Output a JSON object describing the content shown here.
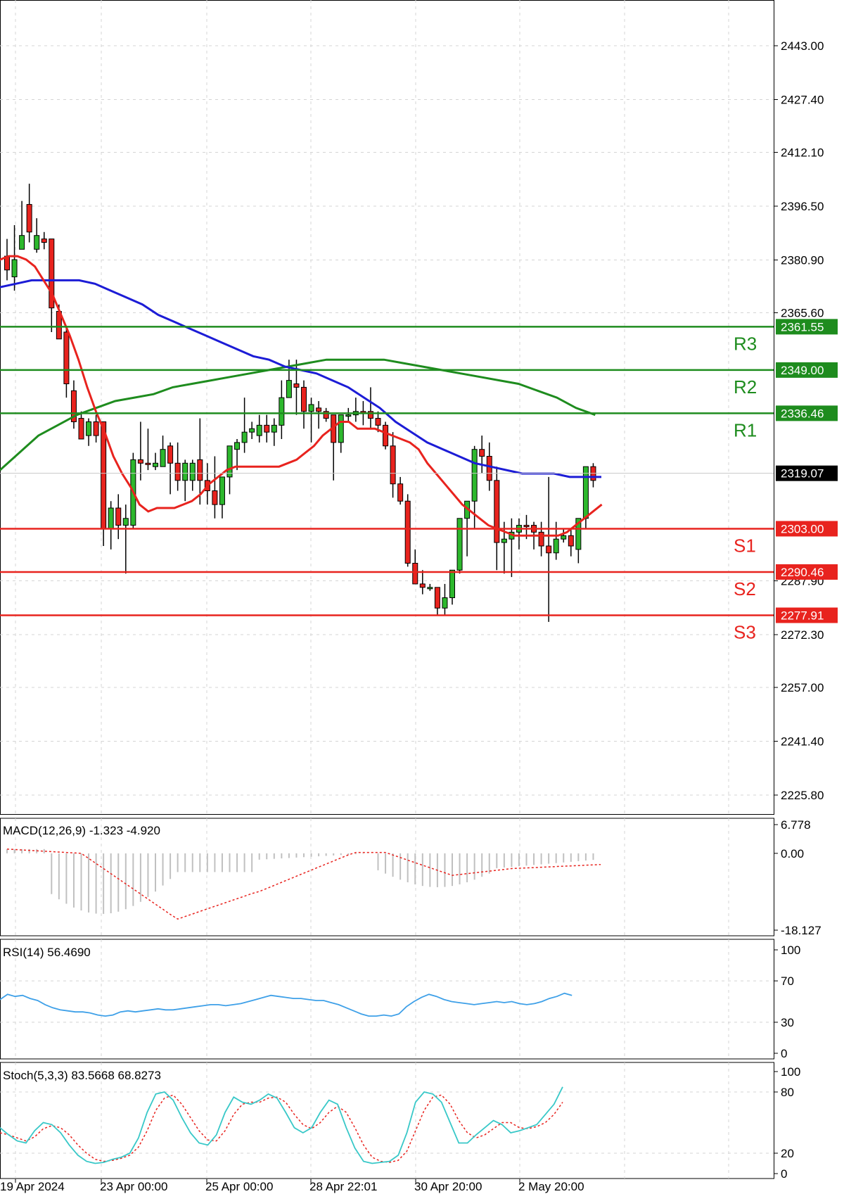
{
  "chart_data": {
    "type": "candlestick",
    "price_axis": {
      "ticks": [
        "2443.00",
        "2427.40",
        "2412.10",
        "2396.50",
        "2380.90",
        "2365.60",
        "2287.90",
        "2272.30",
        "2257.00",
        "2241.40",
        "2225.80"
      ],
      "tick_values": [
        2443.0,
        2427.4,
        2412.1,
        2396.5,
        2380.9,
        2365.6,
        2287.9,
        2272.3,
        2257.0,
        2241.4,
        2225.8
      ]
    },
    "current_price": {
      "label": "2319.07",
      "value": 2319.07
    },
    "levels": [
      {
        "name": "R3",
        "label": "2361.55",
        "value": 2361.55,
        "color": "#1e8c1e"
      },
      {
        "name": "R2",
        "label": "2349.00",
        "value": 2349.0,
        "color": "#1e8c1e"
      },
      {
        "name": "R1",
        "label": "2336.46",
        "value": 2336.46,
        "color": "#1e8c1e"
      },
      {
        "name": "S1",
        "label": "2303.00",
        "value": 2303.0,
        "color": "#e8231e"
      },
      {
        "name": "S2",
        "label": "2290.46",
        "value": 2290.46,
        "color": "#e8231e"
      },
      {
        "name": "S3",
        "label": "2277.91",
        "value": 2277.91,
        "color": "#e8231e"
      }
    ],
    "time_labels": [
      "19 Apr 2024",
      "23 Apr 00:00",
      "25 Apr 00:00",
      "28 Apr 22:01",
      "30 Apr 20:00",
      "2 May 20:00"
    ],
    "candles": [
      [
        2382,
        2387,
        2378,
        2375,
        "bear"
      ],
      [
        2381,
        2391,
        2376,
        2372,
        "bull"
      ],
      [
        2388,
        2398,
        2384,
        2384,
        "bull"
      ],
      [
        2389,
        2403,
        2397,
        2386,
        "bear"
      ],
      [
        2388,
        2393,
        2384,
        2383,
        "bull"
      ],
      [
        2387,
        2389,
        2386,
        2384,
        "bear"
      ],
      [
        2387,
        2387,
        2367,
        2360,
        "bear"
      ],
      [
        2366,
        2368,
        2358,
        2358,
        "bear"
      ],
      [
        2360,
        2361,
        2345,
        2341,
        "bear"
      ],
      [
        2343,
        2346,
        2334,
        2332,
        "bear"
      ],
      [
        2335,
        2337,
        2329,
        2329,
        "bear"
      ],
      [
        2330,
        2335,
        2334,
        2327,
        "bull"
      ],
      [
        2334,
        2336,
        2330,
        2328,
        "bear"
      ],
      [
        2334,
        2334,
        2303,
        2298,
        "bear"
      ],
      [
        2303,
        2311,
        2309,
        2297,
        "bull"
      ],
      [
        2309,
        2313,
        2304,
        2300,
        "bear"
      ],
      [
        2304,
        2310,
        2306,
        2290,
        "bull"
      ],
      [
        2304,
        2325,
        2323,
        2303,
        "bull"
      ],
      [
        2323,
        2334,
        2322,
        2317,
        "bear"
      ],
      [
        2322,
        2332,
        2322,
        2320,
        "bear"
      ],
      [
        2321,
        2325,
        2322,
        2320,
        "bull"
      ],
      [
        2321,
        2330,
        2326,
        2321,
        "bull"
      ],
      [
        2327,
        2328,
        2322,
        2313,
        "bear"
      ],
      [
        2322,
        2328,
        2317,
        2314,
        "bear"
      ],
      [
        2317,
        2323,
        2322,
        2311,
        "bull"
      ],
      [
        2317,
        2323,
        2322,
        2314,
        "bull"
      ],
      [
        2323,
        2335,
        2317,
        2310,
        "bear"
      ],
      [
        2317,
        2322,
        2314,
        2310,
        "bear"
      ],
      [
        2314,
        2324,
        2310,
        2306,
        "bear"
      ],
      [
        2310,
        2318,
        2318,
        2306,
        "bull"
      ],
      [
        2318,
        2327,
        2327,
        2313,
        "bull"
      ],
      [
        2326,
        2329,
        2328,
        2320,
        "bull"
      ],
      [
        2328,
        2341,
        2331,
        2325,
        "bull"
      ],
      [
        2331,
        2334,
        2332,
        2329,
        "bull"
      ],
      [
        2330,
        2336,
        2333,
        2328,
        "bull"
      ],
      [
        2333,
        2336,
        2331,
        2328,
        "bear"
      ],
      [
        2331,
        2335,
        2333,
        2327,
        "bull"
      ],
      [
        2333,
        2346,
        2341,
        2329,
        "bull"
      ],
      [
        2341,
        2352,
        2346,
        2341,
        "bull"
      ],
      [
        2345,
        2352,
        2344,
        2336,
        "bear"
      ],
      [
        2344,
        2346,
        2337,
        2332,
        "bear"
      ],
      [
        2337,
        2341,
        2339,
        2328,
        "bull"
      ],
      [
        2338,
        2340,
        2337,
        2332,
        "bear"
      ],
      [
        2337,
        2338,
        2335,
        2334,
        "bear"
      ],
      [
        2336,
        2336,
        2328,
        2317,
        "bear"
      ],
      [
        2328,
        2335,
        2336,
        2325,
        "bull"
      ],
      [
        2336,
        2338,
        2336,
        2334,
        "bull"
      ],
      [
        2336,
        2341,
        2337,
        2334,
        "bull"
      ],
      [
        2337,
        2340,
        2337,
        2333,
        "bear"
      ],
      [
        2337,
        2344,
        2335,
        2332,
        "bear"
      ],
      [
        2335,
        2337,
        2333,
        2331,
        "bear"
      ],
      [
        2333,
        2334,
        2327,
        2326,
        "bear"
      ],
      [
        2327,
        2331,
        2316,
        2312,
        "bear"
      ],
      [
        2316,
        2318,
        2311,
        2310,
        "bear"
      ],
      [
        2311,
        2313,
        2293,
        2292,
        "bear"
      ],
      [
        2293,
        2297,
        2287,
        2287,
        "bear"
      ],
      [
        2287,
        2291,
        2286,
        2284,
        "bear"
      ],
      [
        2286,
        2287,
        2286,
        2285,
        "bull"
      ],
      [
        2286,
        2286,
        2280,
        2278,
        "bear"
      ],
      [
        2280,
        2287,
        2283,
        2278,
        "bull"
      ],
      [
        2283,
        2291,
        2291,
        2281,
        "bull"
      ],
      [
        2291,
        2306,
        2306,
        2290,
        "bull"
      ],
      [
        2306,
        2311,
        2311,
        2295,
        "bull"
      ],
      [
        2311,
        2327,
        2326,
        2303,
        "bull"
      ],
      [
        2326,
        2330,
        2324,
        2319,
        "bear"
      ],
      [
        2324,
        2328,
        2317,
        2314,
        "bear"
      ],
      [
        2317,
        2321,
        2299,
        2291,
        "bear"
      ],
      [
        2299,
        2305,
        2300,
        2290,
        "bull"
      ],
      [
        2300,
        2306,
        2302,
        2289,
        "bull"
      ],
      [
        2302,
        2306,
        2304,
        2297,
        "bull"
      ],
      [
        2304,
        2307,
        2304,
        2300,
        "bear"
      ],
      [
        2304,
        2305,
        2302,
        2297,
        "bear"
      ],
      [
        2302,
        2305,
        2298,
        2295,
        "bear"
      ],
      [
        2298,
        2318,
        2296,
        2276,
        "bear"
      ],
      [
        2296,
        2305,
        2300,
        2294,
        "bull"
      ],
      [
        2300,
        2303,
        2301,
        2299,
        "bull"
      ],
      [
        2301,
        2303,
        2298,
        2295,
        "bear"
      ],
      [
        2297,
        2304,
        2306,
        2293,
        "bull"
      ],
      [
        2306,
        2321,
        2321,
        2303,
        "bull"
      ],
      [
        2321,
        2322,
        2317,
        2315,
        "bear"
      ]
    ],
    "indicators": {
      "ema_red": [
        2381,
        2382,
        2382,
        2381,
        2379,
        2375,
        2371,
        2365,
        2359,
        2352,
        2344,
        2337,
        2331,
        2324,
        2319,
        2315,
        2310,
        2308,
        2309,
        2309,
        2309,
        2310,
        2311,
        2313,
        2316,
        2318,
        2320,
        2321,
        2321,
        2321,
        2321,
        2321,
        2321,
        2322,
        2323,
        2325,
        2327,
        2330,
        2332,
        2334,
        2334,
        2332,
        2332,
        2332,
        2331,
        2330,
        2329,
        2328,
        2326,
        2322,
        2319,
        2316,
        2313,
        2310,
        2308,
        2306,
        2304,
        2303,
        2302,
        2301,
        2301,
        2301,
        2301,
        2301,
        2301,
        2302,
        2304,
        2306,
        2308,
        2310
      ],
      "sma_blue": [
        2373,
        2374,
        2375,
        2375,
        2375,
        2375,
        2374,
        2372,
        2370,
        2368,
        2365,
        2363,
        2361,
        2359,
        2357,
        2355,
        2353,
        2352,
        2350,
        2349,
        2348,
        2346,
        2344,
        2341,
        2338,
        2334,
        2331,
        2328,
        2326,
        2324,
        2322,
        2321,
        2320,
        2319,
        2319,
        2319,
        2318,
        2318,
        2318
      ],
      "sma_green": [
        2320,
        2325,
        2330,
        2333,
        2336,
        2338,
        2340,
        2341,
        2342,
        2344,
        2345,
        2346,
        2347,
        2348,
        2349,
        2350,
        2351,
        2352,
        2352,
        2352,
        2352,
        2351,
        2350,
        2349,
        2348,
        2347,
        2346,
        2345,
        2343,
        2341,
        2338,
        2336
      ]
    },
    "macd": {
      "label": "MACD(12,26,9) -1.323 -4.920",
      "ticks": [
        "6.778",
        "0.00",
        "-18.127"
      ],
      "tick_values": [
        6.778,
        0,
        -18.127
      ]
    },
    "rsi": {
      "label": "RSI(14) 56.4690",
      "ticks": [
        "100",
        "70",
        "30",
        "0"
      ],
      "tick_values": [
        100,
        70,
        30,
        0
      ],
      "values": [
        52,
        57,
        55,
        56,
        53,
        51,
        47,
        44,
        42,
        41,
        40,
        40,
        39,
        37,
        36,
        37,
        40,
        41,
        40,
        41,
        42,
        43,
        42,
        42,
        43,
        44,
        45,
        46,
        47,
        47,
        46,
        47,
        48,
        50,
        52,
        54,
        56,
        55,
        54,
        53,
        53,
        52,
        51,
        51,
        49,
        47,
        44,
        41,
        38,
        36,
        36,
        37,
        36,
        38,
        45,
        50,
        54,
        57,
        55,
        52,
        50,
        49,
        48,
        47,
        48,
        49,
        50,
        49,
        50,
        48,
        47,
        48,
        50,
        53,
        55,
        58,
        56
      ]
    },
    "stoch": {
      "label": "Stoch(5,3,3) 83.5668 68.8273",
      "ticks": [
        "100",
        "80",
        "20",
        "0"
      ],
      "tick_values": [
        100,
        80,
        20,
        0
      ]
    }
  }
}
